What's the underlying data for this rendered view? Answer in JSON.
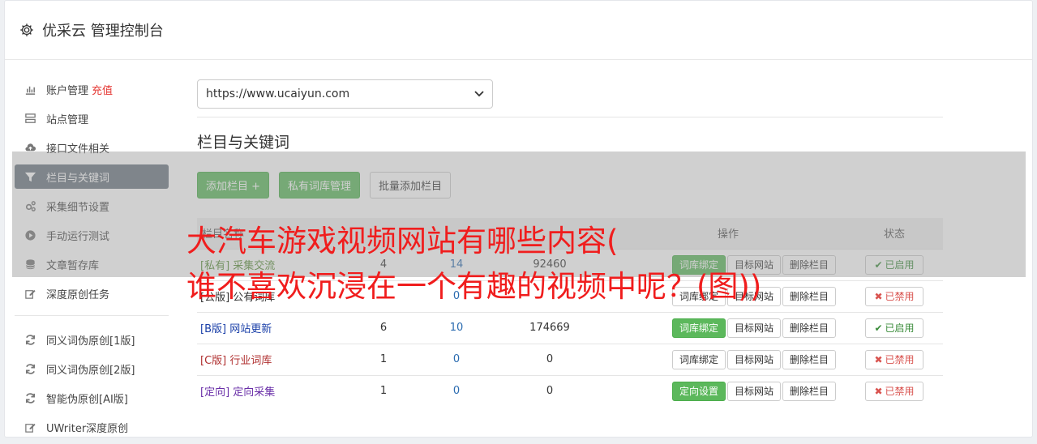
{
  "header": {
    "title": "优采云 管理控制台"
  },
  "sidebar": {
    "items": [
      {
        "label": "账户管理",
        "extra": "充值",
        "icon": "bar-chart-icon"
      },
      {
        "label": "站点管理",
        "icon": "server-icon"
      },
      {
        "label": "接口文件相关",
        "icon": "cloud-upload-icon"
      },
      {
        "label": "栏目与关键词",
        "icon": "filter-icon",
        "active": true
      },
      {
        "label": "采集细节设置",
        "icon": "cogs-icon"
      },
      {
        "label": "手动运行测试",
        "icon": "play-circle-icon"
      },
      {
        "label": "文章暂存库",
        "icon": "database-icon"
      },
      {
        "label": "深度原创任务",
        "icon": "edit-icon"
      }
    ],
    "items2": [
      {
        "label": "同义词伪原创[1版]",
        "icon": "refresh-icon"
      },
      {
        "label": "同义词伪原创[2版]",
        "icon": "refresh-icon"
      },
      {
        "label": "智能伪原创[AI版]",
        "icon": "refresh-icon"
      },
      {
        "label": "UWriter深度原创",
        "icon": "edit-icon"
      }
    ]
  },
  "site_select": {
    "value": "https://www.ucaiyun.com"
  },
  "section": {
    "title": "栏目与关键词"
  },
  "toolbar": {
    "add_column": "添加栏目 +",
    "private_lib": "私有词库管理",
    "batch_add": "批量添加栏目"
  },
  "table": {
    "headers": {
      "name": "栏目名称",
      "col2": "",
      "col3": "",
      "col4": "",
      "ops": "操作",
      "status": "状态"
    },
    "rows": [
      {
        "tag": "[私有]",
        "name": "采集交流",
        "a": "4",
        "b": "14",
        "c": "92460",
        "op1": "词库绑定",
        "op1_green": true,
        "op2": "目标网站",
        "op3": "删除栏目",
        "status": "已启用",
        "on": true,
        "tag_color": "#5a8f3a"
      },
      {
        "tag": "[公版]",
        "name": "公有词库",
        "a": "",
        "b": "0",
        "c": "",
        "op1": "词库绑定",
        "op1_green": false,
        "op2": "目标网站",
        "op3": "删除栏目",
        "status": "已禁用",
        "on": false,
        "tag_color": "#333333"
      },
      {
        "tag": "[B版]",
        "name": "网站更新",
        "a": "6",
        "b": "10",
        "c": "174669",
        "op1": "词库绑定",
        "op1_green": true,
        "op2": "目标网站",
        "op3": "删除栏目",
        "status": "已启用",
        "on": true,
        "tag_color": "#1a3fa8"
      },
      {
        "tag": "[C版]",
        "name": "行业词库",
        "a": "1",
        "b": "0",
        "c": "0",
        "op1": "词库绑定",
        "op1_green": false,
        "op2": "目标网站",
        "op3": "删除栏目",
        "status": "已禁用",
        "on": false,
        "tag_color": "#b03030"
      },
      {
        "tag": "[定向]",
        "name": "定向采集",
        "a": "1",
        "b": "0",
        "c": "0",
        "op1": "定向设置",
        "op1_green": true,
        "op2": "目标网站",
        "op3": "删除栏目",
        "status": "已禁用",
        "on": false,
        "tag_color": "#6a2fa8"
      }
    ]
  },
  "overlay": {
    "line1": "大汽车游戏视频网站有哪些内容(",
    "line2": "谁不喜欢沉浸在一个有趣的视频中呢？(图))"
  },
  "colors": {
    "green": "#5cb85c",
    "red": "#e53935",
    "active_nav": "#6c7781"
  }
}
